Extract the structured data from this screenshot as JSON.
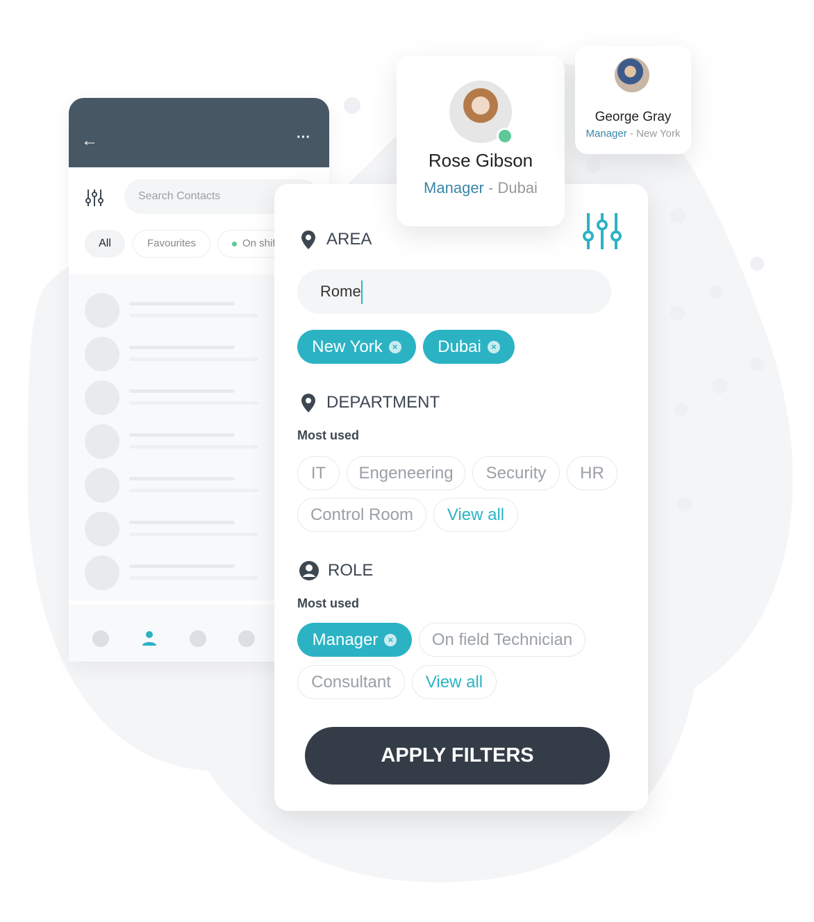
{
  "colors": {
    "accent": "#2bb3c4",
    "header": "#475764",
    "button": "#343d47",
    "online": "#5ec996"
  },
  "contacts_screen": {
    "search_placeholder": "Search Contacts",
    "tabs": [
      "All",
      "Favourites",
      "On shift"
    ]
  },
  "profile_cards": [
    {
      "name": "Rose Gibson",
      "role": "Manager",
      "location": "Dubai",
      "online": true
    },
    {
      "name": "George Gray",
      "role": "Manager",
      "location": "New York"
    }
  ],
  "filter": {
    "area": {
      "title": "AREA",
      "input_value": "Rome",
      "chips": [
        "New York",
        "Dubai"
      ]
    },
    "department": {
      "title": "DEPARTMENT",
      "subtitle": "Most used",
      "options": [
        "IT",
        "Engeneering",
        "Security",
        "HR",
        "Control Room"
      ],
      "view_all": "View all"
    },
    "role": {
      "title": "ROLE",
      "subtitle": "Most used",
      "selected": [
        "Manager"
      ],
      "options": [
        "On field Technician",
        "Consultant"
      ],
      "view_all": "View all"
    },
    "apply_label": "APPLY FILTERS"
  }
}
